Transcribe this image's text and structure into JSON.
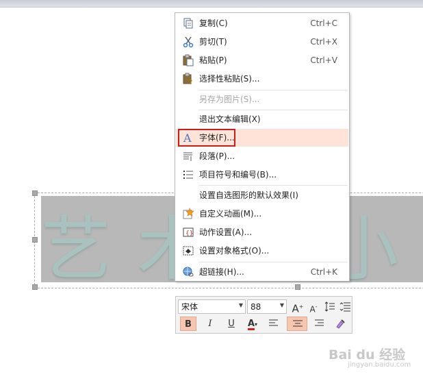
{
  "slide": {
    "wordart_text": "艺术字小书"
  },
  "context_menu": {
    "items": [
      {
        "label": "复制(C)",
        "shortcut": "Ctrl+C",
        "icon": "copy-icon"
      },
      {
        "label": "剪切(T)",
        "shortcut": "Ctrl+X",
        "icon": "scissors-icon"
      },
      {
        "label": "粘贴(P)",
        "shortcut": "Ctrl+V",
        "icon": "paste-icon"
      },
      {
        "label": "选择性粘贴(S)...",
        "shortcut": "",
        "icon": "paste-special-icon"
      },
      {
        "label": "另存为图片(S)...",
        "shortcut": "",
        "icon": "",
        "disabled": true
      },
      {
        "label": "退出文本编辑(X)",
        "shortcut": "",
        "icon": ""
      },
      {
        "label": "字体(F)...",
        "shortcut": "",
        "icon": "font-icon",
        "highlighted": true
      },
      {
        "label": "段落(P)...",
        "shortcut": "",
        "icon": "paragraph-icon"
      },
      {
        "label": "项目符号和编号(B)...",
        "shortcut": "",
        "icon": "bullets-icon"
      },
      {
        "label": "设置自选图形的默认效果(I)",
        "shortcut": "",
        "icon": ""
      },
      {
        "label": "自定义动画(M)...",
        "shortcut": "",
        "icon": "animation-icon"
      },
      {
        "label": "动作设置(A)...",
        "shortcut": "",
        "icon": "action-icon"
      },
      {
        "label": "设置对象格式(O)...",
        "shortcut": "",
        "icon": "format-object-icon"
      },
      {
        "label": "超链接(H)...",
        "shortcut": "Ctrl+K",
        "icon": "hyperlink-icon"
      }
    ]
  },
  "mini_toolbar": {
    "font_name": "宋体",
    "font_size": "88",
    "bold": "B",
    "italic": "I",
    "underline": "U",
    "font_color_letter": "A",
    "grow_font_letter": "A",
    "shrink_font_letter": "A",
    "font_color": "#d92020"
  },
  "watermark": {
    "text": "Bai du 经验",
    "sub": "jingyan.baidu.com"
  }
}
